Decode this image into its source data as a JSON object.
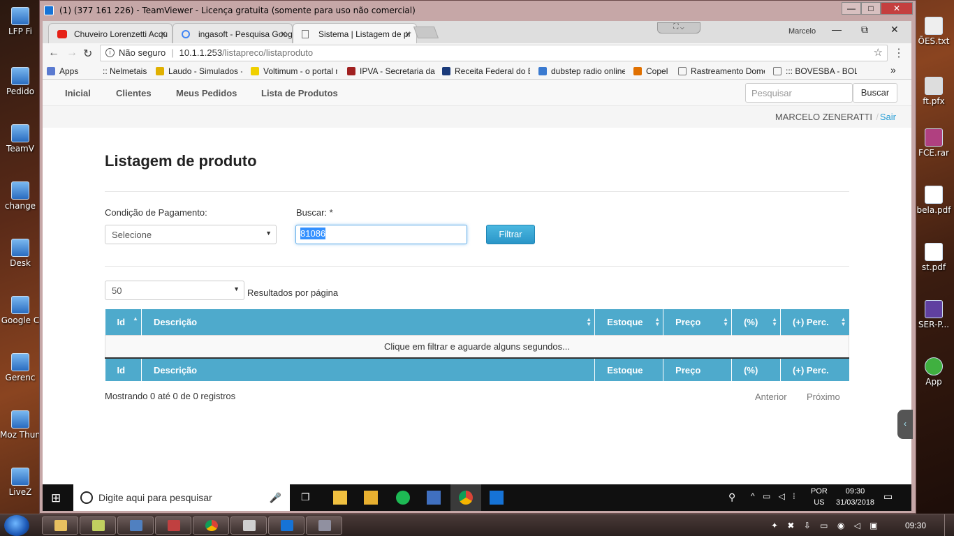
{
  "desktop": {
    "left_icons": [
      "LFP Fi",
      "Pedido",
      "TeamV",
      "change",
      "Desk",
      "Google C",
      "Gerenc",
      "Moz Thunde",
      "LiveZ"
    ],
    "right_icons": [
      "ÕES.txt",
      "ft.pfx",
      "FCE.rar",
      "bela.pdf",
      "st.pdf",
      "SER-P...",
      "App"
    ]
  },
  "teamviewer": {
    "title": "(1) (377 161 226) - TeamViewer - Licença gratuita (somente para uso não comercial)",
    "min": "—",
    "max": "□",
    "close": "✕"
  },
  "browser": {
    "tabs": [
      {
        "label": "Chuveiro Lorenzetti Acqu",
        "color": "#e62117"
      },
      {
        "label": "ingasoft - Pesquisa Goog",
        "color": "#4285f4"
      },
      {
        "label": "Sistema | Listagem de pr",
        "color": "#777777"
      }
    ],
    "user": "Marcelo",
    "win_min": "—",
    "win_max": "⧉",
    "win_close": "✕",
    "security": "Não seguro",
    "url_host": "10.1.1.253",
    "url_path": "/listapreco/listaproduto",
    "bookmarks": [
      {
        "label": "Apps",
        "color": "#5a7ad0"
      },
      {
        "label": ":: Nelmetais ::",
        "color": "#ffffff"
      },
      {
        "label": "Laudo - Simulados - I",
        "color": "#e0b000"
      },
      {
        "label": "Voltimum - o portal n",
        "color": "#f0d000"
      },
      {
        "label": "IPVA - Secretaria da F",
        "color": "#a02020"
      },
      {
        "label": "Receita Federal do Br",
        "color": "#1a3a7a"
      },
      {
        "label": "dubstep radio online",
        "color": "#3a7ad0"
      },
      {
        "label": "Copel",
        "color": "#e07000"
      },
      {
        "label": "Rastreamento Domé",
        "color": "#ffffff"
      },
      {
        "label": "::: BOVESBA - BOLSA",
        "color": "#ffffff"
      }
    ],
    "more": "»"
  },
  "navbar": {
    "links": [
      "Inicial",
      "Clientes",
      "Meus Pedidos",
      "Lista de Produtos"
    ],
    "search_placeholder": "Pesquisar",
    "search_button": "Buscar"
  },
  "user": {
    "name": "MARCELO ZENERATTI",
    "sep": "/",
    "logout": "Sair"
  },
  "page": {
    "title": "Listagem de produto",
    "payment_label": "Condição de Pagamento:",
    "payment_value": "Selecione",
    "search_label": "Buscar: *",
    "search_value": "81086",
    "filter_button": "Filtrar",
    "page_size": "50",
    "page_size_label": "Resultados por página",
    "columns": [
      "Id",
      "Descrição",
      "Estoque",
      "Preço",
      "(%)",
      "(+) Perc."
    ],
    "empty_message": "Clique em filtrar e aguarde alguns segundos...",
    "info": "Mostrando 0 até 0 de 0 registros",
    "prev": "Anterior",
    "next": "Próximo"
  },
  "remote_taskbar": {
    "search_placeholder": "Digite aqui para pesquisar",
    "lang1": "POR",
    "lang2": "US",
    "time": "09:30",
    "date": "31/03/2018"
  },
  "local_taskbar": {
    "time": "09:30"
  }
}
